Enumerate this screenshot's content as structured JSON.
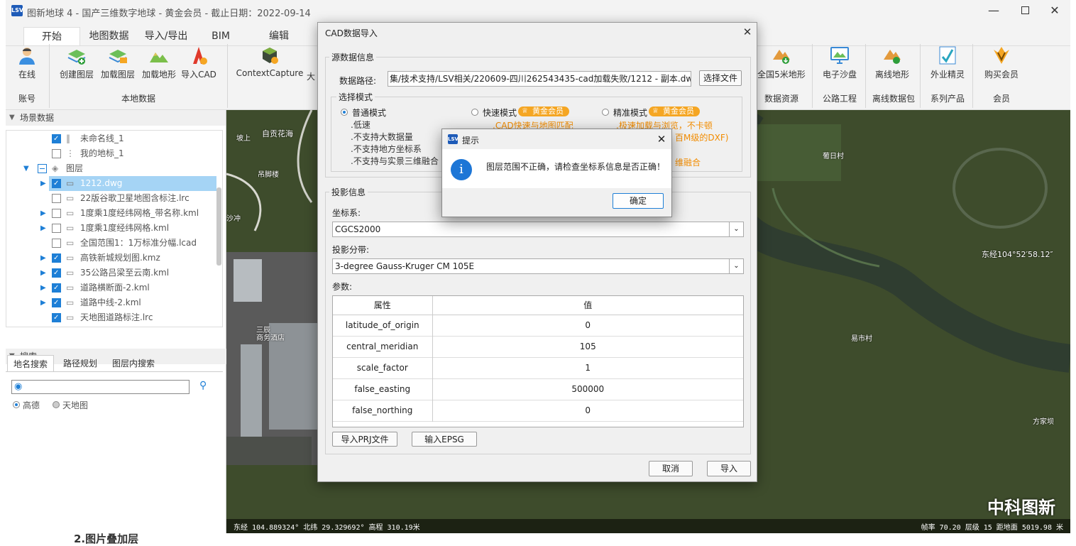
{
  "window": {
    "title": "图新地球 4 - 国产三维数字地球 - 黄金会员 - 截止日期：2022-09-14"
  },
  "ribbon": {
    "tabs": [
      "开始",
      "地图数据",
      "导入/导出",
      "BIM",
      "编辑"
    ],
    "left_buttons": [
      "在线",
      "创建图层",
      "加载图层",
      "加载地形",
      "导入CAD",
      "ContextCapture"
    ],
    "clip_label": "大",
    "left_groups": [
      "账号",
      "本地数据"
    ],
    "right_buttons": [
      "全国5米地形",
      "电子沙盘",
      "离线地形",
      "外业精灵",
      "购买会员"
    ],
    "right_groups": [
      "数据资源",
      "公路工程",
      "离线数据包",
      "系列产品",
      "会员"
    ]
  },
  "scene": {
    "header": "场景数据",
    "items": [
      {
        "label": "未命名线_1",
        "checked": true
      },
      {
        "label": "我的地标_1",
        "checked": false
      },
      {
        "label": "图层",
        "checked": false
      },
      {
        "label": "1212.dwg",
        "checked": true
      },
      {
        "label": "22版谷歌卫星地图含标注.lrc",
        "checked": false
      },
      {
        "label": "1度乘1度经纬网格_带名称.kml",
        "checked": false
      },
      {
        "label": "1度乘1度经纬网格.kml",
        "checked": false
      },
      {
        "label": "全国范围1：1万标准分幅.lcad",
        "checked": false
      },
      {
        "label": "高铁新城规划图.kmz",
        "checked": true
      },
      {
        "label": "35公路吕梁至云南.kml",
        "checked": true
      },
      {
        "label": "道路横断面-2.kml",
        "checked": true
      },
      {
        "label": "道路中线-2.kml",
        "checked": true
      },
      {
        "label": "天地图道路标注.lrc",
        "checked": true
      }
    ]
  },
  "search": {
    "header": "搜索",
    "tabs": [
      "地名搜索",
      "路径规划",
      "图层内搜索"
    ],
    "input_value": "",
    "providers": [
      "高德",
      "天地图"
    ]
  },
  "cad_dialog": {
    "title": "CAD数据导入",
    "source_section": "源数据信息",
    "path_label": "数据路径:",
    "path_value": "集/技术支持/LSV相关/220609-四川262543435-cad加载失败/1212 - 副本.dwg",
    "choose_file": "选择文件",
    "mode_section": "选择模式",
    "modes": [
      {
        "name": "普通模式",
        "selected": true,
        "vip": "",
        "lines": [
          ".低速",
          ".不支持大数据量",
          ".不支持地方坐标系",
          ".不支持与实景三维融合"
        ]
      },
      {
        "name": "快速模式",
        "selected": false,
        "vip": "黄金会员",
        "lines": [
          ".CAD快速与地图匹配"
        ]
      },
      {
        "name": "精准模式",
        "selected": false,
        "vip": "黄金会员",
        "lines": [
          ".极速加载与浏览，不卡顿",
          "百M级的DXF)",
          "维融合"
        ]
      }
    ],
    "proj_section": "投影信息",
    "crs_label": "坐标系:",
    "crs_value": "CGCS2000",
    "zone_label": "投影分带:",
    "zone_value": "3-degree Gauss-Kruger CM 105E",
    "params_label": "参数:",
    "table_headers": [
      "属性",
      "值"
    ],
    "params": [
      {
        "name": "latitude_of_origin",
        "value": "0"
      },
      {
        "name": "central_meridian",
        "value": "105"
      },
      {
        "name": "scale_factor",
        "value": "1"
      },
      {
        "name": "false_easting",
        "value": "500000"
      },
      {
        "name": "false_northing",
        "value": "0"
      }
    ],
    "import_prj": "导入PRJ文件",
    "input_epsg": "输入EPSG",
    "cancel": "取消",
    "import": "导入"
  },
  "alert": {
    "title": "提示",
    "message": "图层范围不正确，请检查坐标系信息是否正确！",
    "ok": "确定"
  },
  "map": {
    "labels": [
      "自贡花海",
      "坡上",
      "吊脚楼",
      "沙冲",
      "三辰",
      "商务酒店",
      "葡日村",
      "易市村",
      "方家坝"
    ],
    "east_label": "东经104°52′58.12″",
    "status_left": "东经 104.889324° 北纬 29.329692° 高程 310.19米",
    "status_right": "帧率 70.20  层级 15  距地面 5019.98 米",
    "watermark": "中科图新"
  },
  "bottom_text": "2.图片叠加层"
}
